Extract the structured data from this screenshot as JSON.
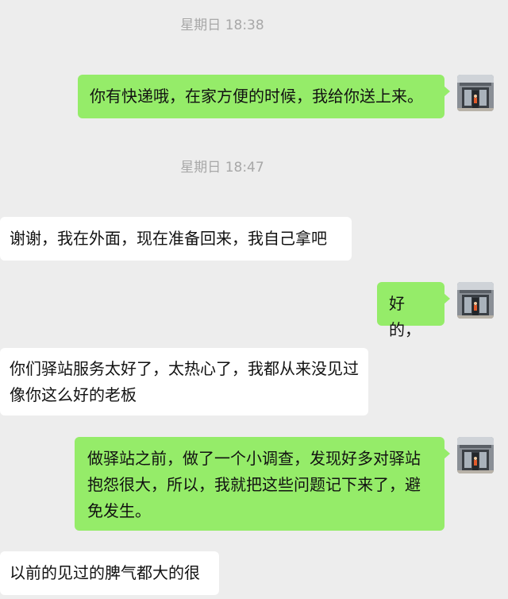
{
  "chat": {
    "timestamps": [
      "星期日 18:38",
      "星期日 18:47"
    ],
    "messages": [
      {
        "side": "out",
        "text": "你有快递哦，在家方便的时候，我给你送上来。"
      },
      {
        "side": "in",
        "text": "谢谢，我在外面，现在准备回来，我自己拿吧"
      },
      {
        "side": "out",
        "text": "好的，"
      },
      {
        "side": "in",
        "text": "你们驿站服务太好了，太热心了，我都从来没见过像你这么好的老板"
      },
      {
        "side": "out",
        "text": "做驿站之前，做了一个小调查，发现好多对驿站抱怨很大，所以，我就把这些问题记下来了，避免发生。"
      },
      {
        "side": "in",
        "text": "以前的见过的脾气都大的很"
      }
    ],
    "avatar_icon": "storefront-photo-avatar",
    "colors": {
      "background": "#ededed",
      "outgoing_bubble": "#95ec69",
      "incoming_bubble": "#ffffff",
      "timestamp_text": "#a8a8a8",
      "message_text": "#111111"
    }
  }
}
